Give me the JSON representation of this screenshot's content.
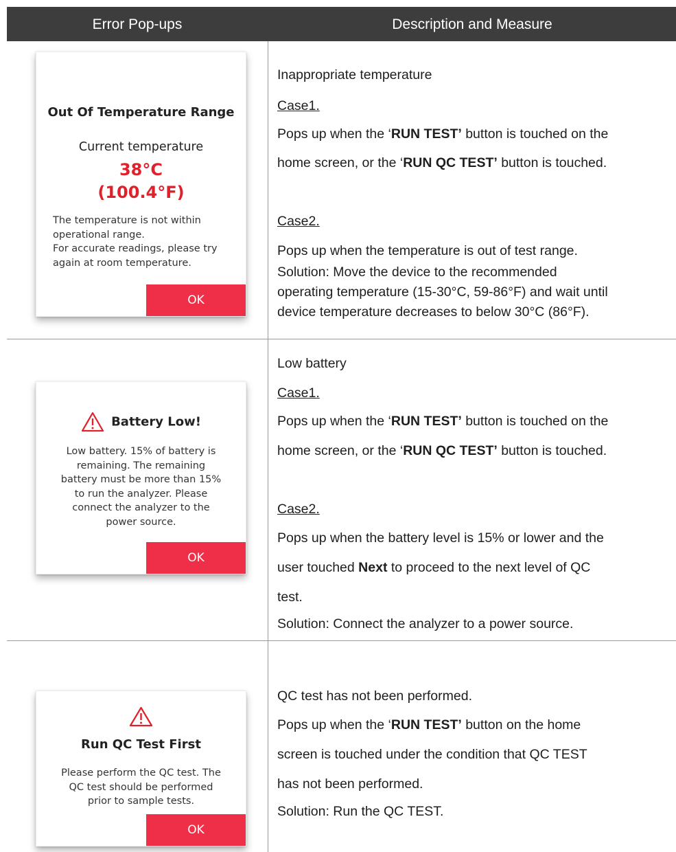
{
  "header": {
    "col1": "Error Pop-ups",
    "col2": "Description and Measure"
  },
  "rows": [
    {
      "popup": {
        "title": "Out Of Temperature Range",
        "subtitle": "Current temperature",
        "temp_c": "38°C",
        "temp_f": "(100.4°F)",
        "body": [
          "The temperature is not within",
          "operational range.",
          "For accurate readings, please try",
          "again at room temperature."
        ],
        "ok_label": "OK"
      },
      "desc": {
        "heading": "Inappropriate temperature",
        "case1_label": "Case1.",
        "case1_lines": [
          [
            "Pops up when the ‘",
            "RUN TEST’",
            " button is touched on the"
          ],
          [
            "home screen, or the ‘",
            "RUN QC TEST’",
            " button is touched."
          ]
        ],
        "case2_label": "Case2.",
        "case2_lines": [
          "Pops up when the temperature is out of test range.",
          "Solution: Move the device to the recommended",
          "operating temperature (15-30°C, 59-86°F) and wait until",
          "device temperature decreases to below 30°C (86°F)."
        ]
      }
    },
    {
      "popup": {
        "title": "Battery Low!",
        "body": [
          "Low battery. 15% of battery is",
          "remaining. The remaining",
          "battery must be more than 15%",
          "to run the analyzer. Please",
          "connect the analyzer to the",
          "power source."
        ],
        "ok_label": "OK",
        "icon": "warning-triangle-icon"
      },
      "desc": {
        "heading": "Low battery",
        "case1_label": "Case1.",
        "case1_lines": [
          [
            "Pops up when the ‘",
            "RUN TEST’",
            " button is touched on the"
          ],
          [
            "home screen, or the ‘",
            "RUN QC TEST’",
            " button is touched."
          ]
        ],
        "case2_label": "Case2.",
        "case2_line1": "Pops up when the battery level is 15% or lower and the",
        "case2_line2_pre": "user touched ",
        "case2_line2_bold": "Next",
        "case2_line2_post": " to proceed to the next level of QC",
        "case2_line3": "test.",
        "solution": "Solution: Connect the analyzer to a power source."
      }
    },
    {
      "popup": {
        "title": "Run QC Test First",
        "body": [
          "Please perform the QC test. The",
          "QC test should be performed",
          "prior to sample tests."
        ],
        "ok_label": "OK",
        "icon": "warning-triangle-icon"
      },
      "desc": {
        "heading": "QC test has not been performed.",
        "line1_pre": "Pops up when the ‘",
        "line1_bold": "RUN TEST’",
        "line1_post": " button on the home",
        "line2": "screen is touched under the condition that QC TEST",
        "line3": "has not been performed.",
        "solution": "Solution: Run the QC TEST."
      }
    }
  ],
  "colors": {
    "header_bg": "#3d3d3d",
    "ok_button": "#ef2f48",
    "temp_red": "#e0202a"
  }
}
